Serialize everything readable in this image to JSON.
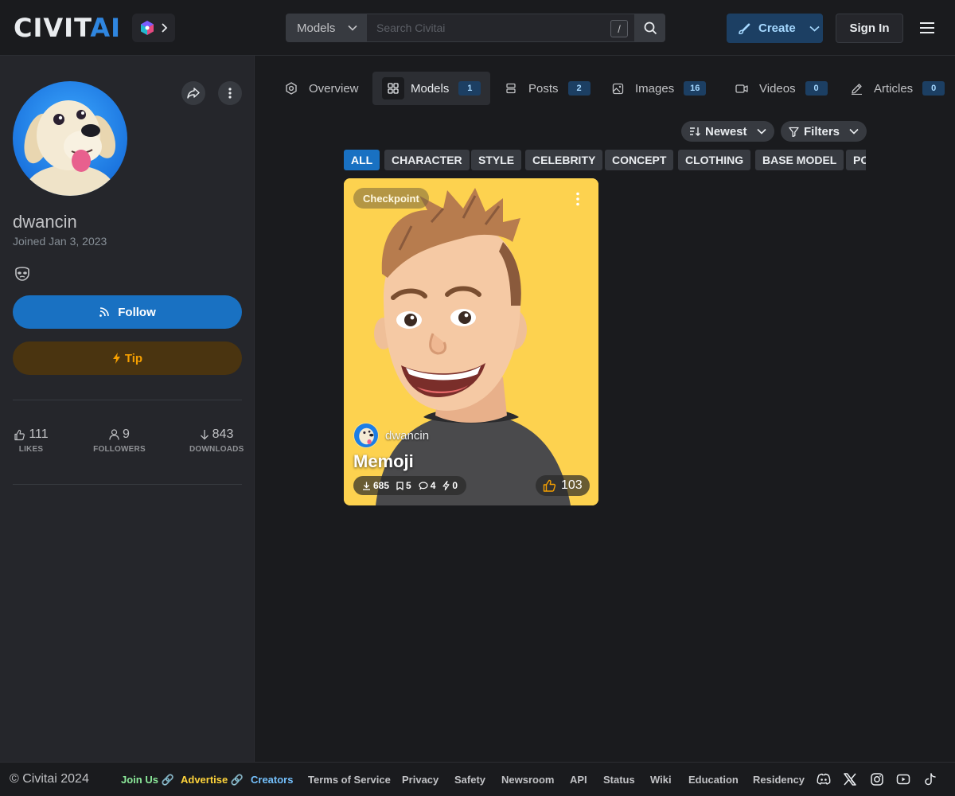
{
  "header": {
    "logo_left": "CIVIT",
    "logo_right": "AI",
    "search": {
      "scope": "Models",
      "placeholder": "Search Civitai",
      "shortcut": "/"
    },
    "create_label": "Create",
    "signin_label": "Sign In"
  },
  "profile": {
    "username": "dwancin",
    "joined": "Joined Jan 3, 2023",
    "follow_label": "Follow",
    "tip_label": "Tip",
    "stats": [
      {
        "value": "111",
        "label": "LIKES",
        "icon": "thumb-up-icon"
      },
      {
        "value": "9",
        "label": "FOLLOWERS",
        "icon": "user-icon"
      },
      {
        "value": "843",
        "label": "DOWNLOADS",
        "icon": "arrow-down-icon"
      }
    ]
  },
  "tabs": [
    {
      "label": "Overview",
      "icon": "overview-icon"
    },
    {
      "label": "Models",
      "count": "1",
      "icon": "grid-icon",
      "active": true
    },
    {
      "label": "Posts",
      "count": "2",
      "icon": "posts-icon"
    },
    {
      "label": "Images",
      "count": "16",
      "icon": "image-icon"
    },
    {
      "label": "Videos",
      "count": "0",
      "icon": "video-icon"
    },
    {
      "label": "Articles",
      "count": "0",
      "icon": "pencil-icon"
    }
  ],
  "controls": {
    "sort_label": "Newest",
    "filters_label": "Filters"
  },
  "categories": [
    "ALL",
    "CHARACTER",
    "STYLE",
    "CELEBRITY",
    "CONCEPT",
    "CLOTHING",
    "BASE MODEL",
    "PO"
  ],
  "card": {
    "type": "Checkpoint",
    "author": "dwancin",
    "title": "Memoji",
    "downloads": "685",
    "bookmarks": "5",
    "comments": "4",
    "tips": "0",
    "likes": "103"
  },
  "footer": {
    "copyright": "© Civitai 2024",
    "links": [
      {
        "label": "Join Us 🔗",
        "color": "#8ce99a"
      },
      {
        "label": "Advertise 🔗",
        "color": "#ffd43b"
      },
      {
        "label": "Creators",
        "color": "#74c0fc"
      },
      {
        "label": "Terms of Service",
        "color": "#c1c2c5"
      },
      {
        "label": "Privacy",
        "color": "#c1c2c5"
      },
      {
        "label": "Safety",
        "color": "#c1c2c5"
      },
      {
        "label": "Newsroom",
        "color": "#c1c2c5"
      },
      {
        "label": "API",
        "color": "#c1c2c5"
      },
      {
        "label": "Status",
        "color": "#c1c2c5"
      },
      {
        "label": "Wiki",
        "color": "#c1c2c5"
      },
      {
        "label": "Education",
        "color": "#c1c2c5"
      },
      {
        "label": "Residency",
        "color": "#c1c2c5"
      }
    ],
    "social": [
      "discord-icon",
      "x-icon",
      "instagram-icon",
      "youtube-icon",
      "tiktok-icon"
    ]
  },
  "colors": {
    "accent": "#1971c2",
    "tip": "#f59f00",
    "card_bg": "#fdd24f"
  }
}
